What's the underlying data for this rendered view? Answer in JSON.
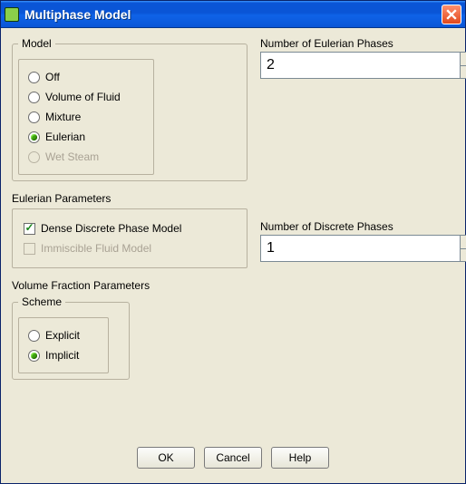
{
  "window": {
    "title": "Multiphase Model"
  },
  "model": {
    "legend": "Model",
    "options": {
      "off": "Off",
      "vof": "Volume of Fluid",
      "mixture": "Mixture",
      "eulerian": "Eulerian",
      "wet_steam": "Wet Steam"
    }
  },
  "eulerian_params": {
    "label": "Eulerian Parameters",
    "dense_discrete": "Dense Discrete Phase Model",
    "immiscible": "Immiscible Fluid Model"
  },
  "volume_fraction": {
    "label": "Volume Fraction Parameters",
    "scheme_legend": "Scheme",
    "explicit": "Explicit",
    "implicit": "Implicit"
  },
  "eulerian_phases": {
    "label": "Number of Eulerian Phases",
    "value": "2"
  },
  "discrete_phases": {
    "label": "Number of Discrete Phases",
    "value": "1"
  },
  "buttons": {
    "ok": "OK",
    "cancel": "Cancel",
    "help": "Help"
  }
}
